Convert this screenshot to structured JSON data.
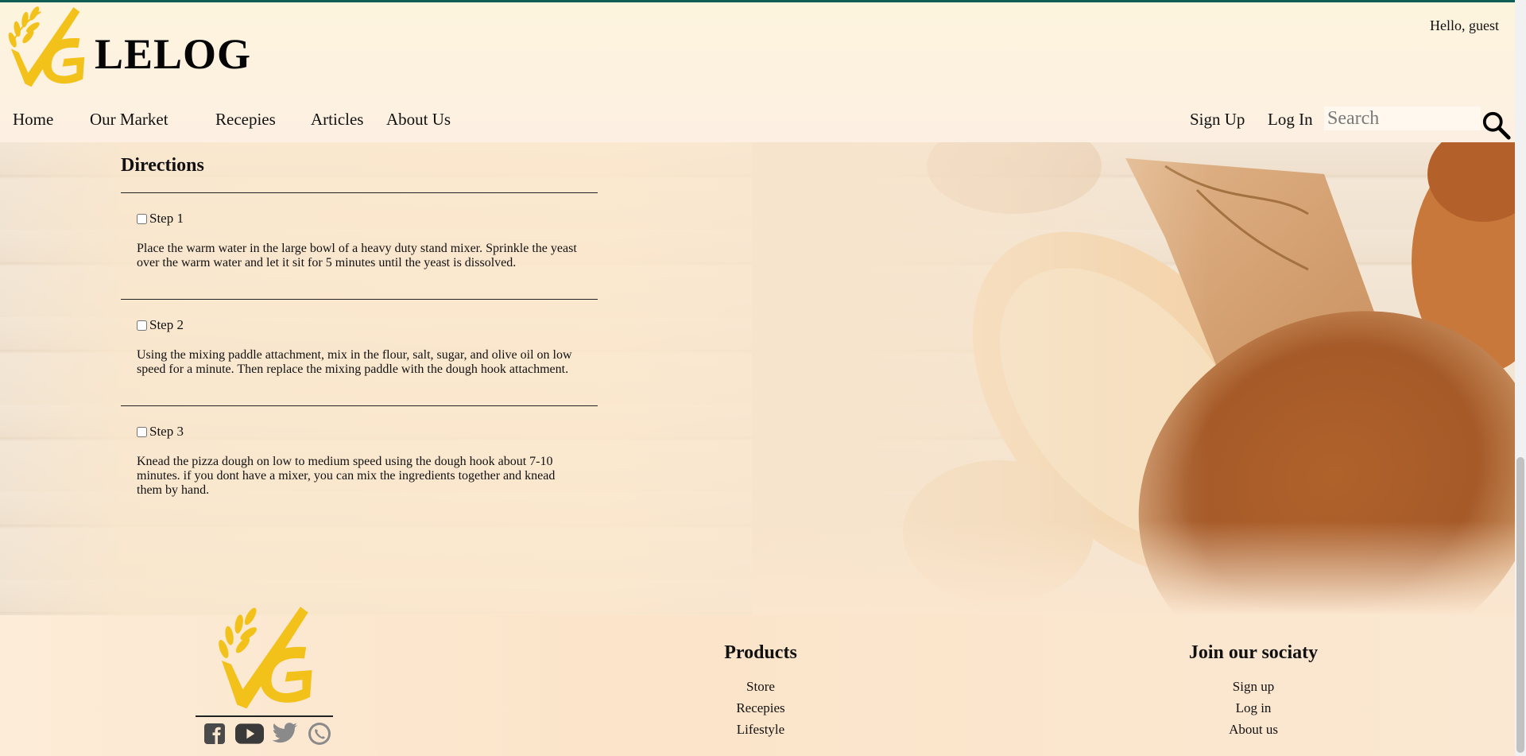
{
  "header": {
    "brand": "LELOG",
    "greeting": "Hello, guest",
    "nav": [
      {
        "label": "Home"
      },
      {
        "label": "Our Market"
      },
      {
        "label": "Recepies"
      },
      {
        "label": "Articles"
      },
      {
        "label": "About Us"
      }
    ],
    "sign_up": "Sign Up",
    "log_in": "Log In",
    "search_placeholder": "Search"
  },
  "directions": {
    "title": "Directions",
    "steps": [
      {
        "label": "Step 1",
        "text": "Place the warm water in the large bowl of a heavy duty stand mixer. Sprinkle the yeast over the warm water and let it sit for 5 minutes until the yeast is dissolved.",
        "checked": false
      },
      {
        "label": "Step 2",
        "text": "Using the mixing paddle attachment, mix in the flour, salt, sugar, and olive oil on low speed for a minute. Then replace the mixing paddle with the dough hook attachment.",
        "checked": false
      },
      {
        "label": "Step 3",
        "text": "Knead the pizza dough on low to medium speed using the dough hook about 7-10 minutes. if you dont have a mixer, you can mix the ingredients together and knead them by hand.",
        "checked": false
      }
    ]
  },
  "footer": {
    "products_title": "Products",
    "products": [
      "Store",
      "Recepies",
      "Lifestyle"
    ],
    "join_title": "Join our sociaty",
    "join": [
      "Sign up",
      "Log in",
      "About us"
    ],
    "socials": [
      "facebook-icon",
      "youtube-icon",
      "twitter-icon",
      "whatsapp-icon"
    ]
  },
  "colors": {
    "accent_top_line": "#0e5e56",
    "logo_gold": "#f2c21b",
    "social_gray": "#4a4a4a"
  }
}
